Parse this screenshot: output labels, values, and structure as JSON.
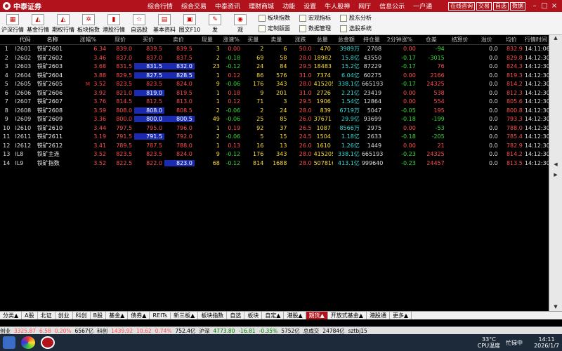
{
  "app": {
    "name": "中泰证券",
    "menu": [
      "综合行情",
      "综合交易",
      "中泰资讯",
      "理财商城",
      "功能",
      "设置",
      "牛人股神",
      "网厅",
      "信息公示",
      "一户通"
    ],
    "title_buttons": [
      "在线咨询",
      "交易",
      "自选",
      "数据"
    ]
  },
  "toolbar": {
    "tools": [
      "沪深行情",
      "基金行情",
      "期权行情",
      "板块指数",
      "港股行情",
      "自选股",
      "基本资料",
      "图文F10",
      "发",
      "观"
    ],
    "extras": [
      "板块指数",
      "宏观指标",
      "股东分析",
      "定制版面",
      "数据管理",
      "选股系统"
    ]
  },
  "table": {
    "headers": [
      "",
      "代码",
      "名称",
      "涨幅%",
      "现价",
      "买价",
      "卖价",
      "现量",
      "涨速%",
      "买量",
      "卖量",
      "涨跌",
      "总量",
      "总金额",
      "持仓量",
      "2分钟涨%",
      "仓差",
      "结算价",
      "溢价",
      "均价",
      "行情时间"
    ],
    "rows": [
      {
        "n": "1",
        "code": "I2601",
        "name": "铁矿2601",
        "chg": "6.34",
        "price": "839.0",
        "bid": "839.5",
        "ask": "839.5",
        "vol": "3",
        "spd": "0.00",
        "bq": "2",
        "aq": "6",
        "up": "50.0",
        "tot": "470",
        "amt": "3989万",
        "oi": "2708",
        "m2": "0.00",
        "oid": "-94",
        "settle": "—",
        "prem": "0.0",
        "avg": "832.9",
        "time": "14:11:06",
        "mark": "",
        "hlb": false,
        "hla": false,
        "dir": "red"
      },
      {
        "n": "2",
        "code": "I2602",
        "name": "铁矿2602",
        "chg": "3.46",
        "price": "837.0",
        "bid": "837.0",
        "ask": "837.5",
        "vol": "2",
        "spd": "-0.18",
        "bq": "69",
        "aq": "58",
        "up": "28.0",
        "tot": "18982",
        "amt": "15.8亿",
        "oi": "43550",
        "m2": "-0.17",
        "oid": "-3015",
        "settle": "—",
        "prem": "0.0",
        "avg": "829.8",
        "time": "14:12:30",
        "mark": "",
        "hlb": false,
        "hla": false,
        "dir": "red"
      },
      {
        "n": "3",
        "code": "I2603",
        "name": "铁矿2603",
        "chg": "3.68",
        "price": "831.5",
        "bid": "831.5",
        "ask": "832.0",
        "vol": "23",
        "spd": "-0.12",
        "bq": "24",
        "aq": "84",
        "up": "29.5",
        "tot": "18483",
        "amt": "15.2亿",
        "oi": "87229",
        "m2": "-0.17",
        "oid": "76",
        "settle": "—",
        "prem": "0.0",
        "avg": "824.3",
        "time": "14:12:30",
        "mark": "",
        "hlb": true,
        "hla": true,
        "dir": "red"
      },
      {
        "n": "4",
        "code": "I2604",
        "name": "铁矿2604",
        "chg": "3.88",
        "price": "829.5",
        "bid": "827.5",
        "ask": "828.5",
        "vol": "1",
        "spd": "0.12",
        "bq": "86",
        "aq": "576",
        "up": "31.0",
        "tot": "7374",
        "amt": "6.04亿",
        "oi": "60275",
        "m2": "0.00",
        "oid": "2166",
        "settle": "—",
        "prem": "0.0",
        "avg": "819.3",
        "time": "14:12:30",
        "mark": "",
        "hlb": true,
        "hla": true,
        "dir": "red"
      },
      {
        "n": "5",
        "code": "I2605",
        "name": "铁矿2605",
        "chg": "3.52",
        "price": "823.5",
        "bid": "823.5",
        "ask": "824.0",
        "vol": "9",
        "spd": "-0.06",
        "bq": "176",
        "aq": "343",
        "up": "28.0",
        "tot": "415205",
        "amt": "338.1亿",
        "oi": "665193",
        "m2": "-0.17",
        "oid": "24325",
        "settle": "—",
        "prem": "0.0",
        "avg": "814.2",
        "time": "14:12:30",
        "mark": "M",
        "hlb": false,
        "hla": false,
        "dir": "red"
      },
      {
        "n": "6",
        "code": "I2606",
        "name": "铁矿2606",
        "chg": "3.92",
        "price": "821.0",
        "bid": "819.0",
        "ask": "819.5",
        "vol": "1",
        "spd": "0.18",
        "bq": "9",
        "aq": "201",
        "up": "31.0",
        "tot": "2726",
        "amt": "2.21亿",
        "oi": "23419",
        "m2": "0.00",
        "oid": "538",
        "settle": "—",
        "prem": "0.0",
        "avg": "812.3",
        "time": "14:12:30",
        "mark": "",
        "hlb": true,
        "hla": false,
        "dir": "red"
      },
      {
        "n": "7",
        "code": "I2607",
        "name": "铁矿2607",
        "chg": "3.76",
        "price": "814.5",
        "bid": "812.5",
        "ask": "813.0",
        "vol": "1",
        "spd": "0.12",
        "bq": "71",
        "aq": "3",
        "up": "29.5",
        "tot": "1906",
        "amt": "1.54亿",
        "oi": "12864",
        "m2": "0.00",
        "oid": "554",
        "settle": "—",
        "prem": "0.0",
        "avg": "805.6",
        "time": "14:12:30",
        "mark": "",
        "hlb": false,
        "hla": false,
        "dir": "red"
      },
      {
        "n": "8",
        "code": "I2608",
        "name": "铁矿2608",
        "chg": "3.59",
        "price": "808.0",
        "bid": "808.0",
        "ask": "808.5",
        "vol": "2",
        "spd": "-0.06",
        "bq": "2",
        "aq": "24",
        "up": "28.0",
        "tot": "839",
        "amt": "6719万",
        "oi": "5047",
        "m2": "-0.05",
        "oid": "195",
        "settle": "—",
        "prem": "0.0",
        "avg": "800.8",
        "time": "14:12:30",
        "mark": "",
        "hlb": true,
        "hla": false,
        "dir": "red"
      },
      {
        "n": "9",
        "code": "I2609",
        "name": "铁矿2609",
        "chg": "3.36",
        "price": "800.0",
        "bid": "800.0",
        "ask": "800.5",
        "vol": "49",
        "spd": "-0.06",
        "bq": "25",
        "aq": "85",
        "up": "26.0",
        "tot": "37671",
        "amt": "29.9亿",
        "oi": "93699",
        "m2": "-0.18",
        "oid": "-199",
        "settle": "—",
        "prem": "0.0",
        "avg": "793.3",
        "time": "14:12:30",
        "mark": "",
        "hlb": true,
        "hla": true,
        "dir": "red"
      },
      {
        "n": "10",
        "code": "I2610",
        "name": "铁矿2610",
        "chg": "3.44",
        "price": "797.5",
        "bid": "795.0",
        "ask": "796.0",
        "vol": "1",
        "spd": "0.19",
        "bq": "92",
        "aq": "37",
        "up": "26.5",
        "tot": "1087",
        "amt": "8566万",
        "oi": "2975",
        "m2": "0.00",
        "oid": "-53",
        "settle": "—",
        "prem": "0.0",
        "avg": "788.0",
        "time": "14:12:30",
        "mark": "",
        "hlb": false,
        "hla": false,
        "dir": "red"
      },
      {
        "n": "11",
        "code": "I2611",
        "name": "铁矿2611",
        "chg": "3.19",
        "price": "791.5",
        "bid": "791.5",
        "ask": "792.0",
        "vol": "2",
        "spd": "-0.06",
        "bq": "5",
        "aq": "15",
        "up": "24.5",
        "tot": "1504",
        "amt": "1.18亿",
        "oi": "2633",
        "m2": "-0.18",
        "oid": "-205",
        "settle": "—",
        "prem": "0.0",
        "avg": "785.4",
        "time": "14:12:30",
        "mark": "",
        "hlb": true,
        "hla": false,
        "dir": "red"
      },
      {
        "n": "12",
        "code": "I2612",
        "name": "铁矿2612",
        "chg": "3.41",
        "price": "789.5",
        "bid": "787.5",
        "ask": "788.0",
        "vol": "1",
        "spd": "0.13",
        "bq": "16",
        "aq": "13",
        "up": "26.0",
        "tot": "1610",
        "amt": "1.26亿",
        "oi": "1449",
        "m2": "0.00",
        "oid": "21",
        "settle": "—",
        "prem": "0.0",
        "avg": "782.9",
        "time": "14:12:30",
        "mark": "",
        "hlb": false,
        "hla": false,
        "dir": "red"
      },
      {
        "n": "13",
        "code": "IL8",
        "name": "铁矿主连",
        "chg": "3.52",
        "price": "823.5",
        "bid": "823.5",
        "ask": "824.0",
        "vol": "9",
        "spd": "-0.12",
        "bq": "176",
        "aq": "343",
        "up": "28.0",
        "tot": "415205",
        "amt": "338.1亿",
        "oi": "665193",
        "m2": "-0.23",
        "oid": "24325",
        "settle": "—",
        "prem": "0.0",
        "avg": "814.2",
        "time": "14:12:30",
        "mark": "",
        "hlb": false,
        "hla": false,
        "dir": "red"
      },
      {
        "n": "14",
        "code": "IL9",
        "name": "铁矿指数",
        "chg": "3.52",
        "price": "822.5",
        "bid": "822.0",
        "ask": "823.0",
        "vol": "68",
        "spd": "-0.12",
        "bq": "814",
        "aq": "1688",
        "up": "28.0",
        "tot": "507816",
        "amt": "413.1亿",
        "oi": "999640",
        "m2": "-0.23",
        "oid": "24457",
        "settle": "—",
        "prem": "0.0",
        "avg": "813.5",
        "time": "14:12:30",
        "mark": "",
        "hlb": false,
        "hla": true,
        "dir": "red"
      }
    ]
  },
  "tabs": [
    "分类▲",
    "A股",
    "北证",
    "创业",
    "科创",
    "B股",
    "基金▲",
    "债券▲",
    "REITs",
    "新三板▲",
    "板块指数",
    "自选",
    "板块",
    "自定▲",
    "港股▲",
    "期货▲",
    "开放式基金▲",
    "港股通",
    "更多▲"
  ],
  "active_tab": "期货▲",
  "status": [
    "创业",
    "3325.87",
    "6.58",
    "0.20%",
    "6567亿",
    "科创",
    "1439.92",
    "10.62",
    "0.74%",
    "752.4亿",
    "沪深",
    "4773.80",
    "-16.81",
    "-0.35%",
    "5752亿",
    "总成交",
    "24784亿",
    "sztbj15"
  ],
  "taskbar": {
    "temp": "33°C",
    "cpu_label": "CPU温度",
    "ime": "忙碌中",
    "time": "14:11",
    "date": "2026/1/7"
  }
}
